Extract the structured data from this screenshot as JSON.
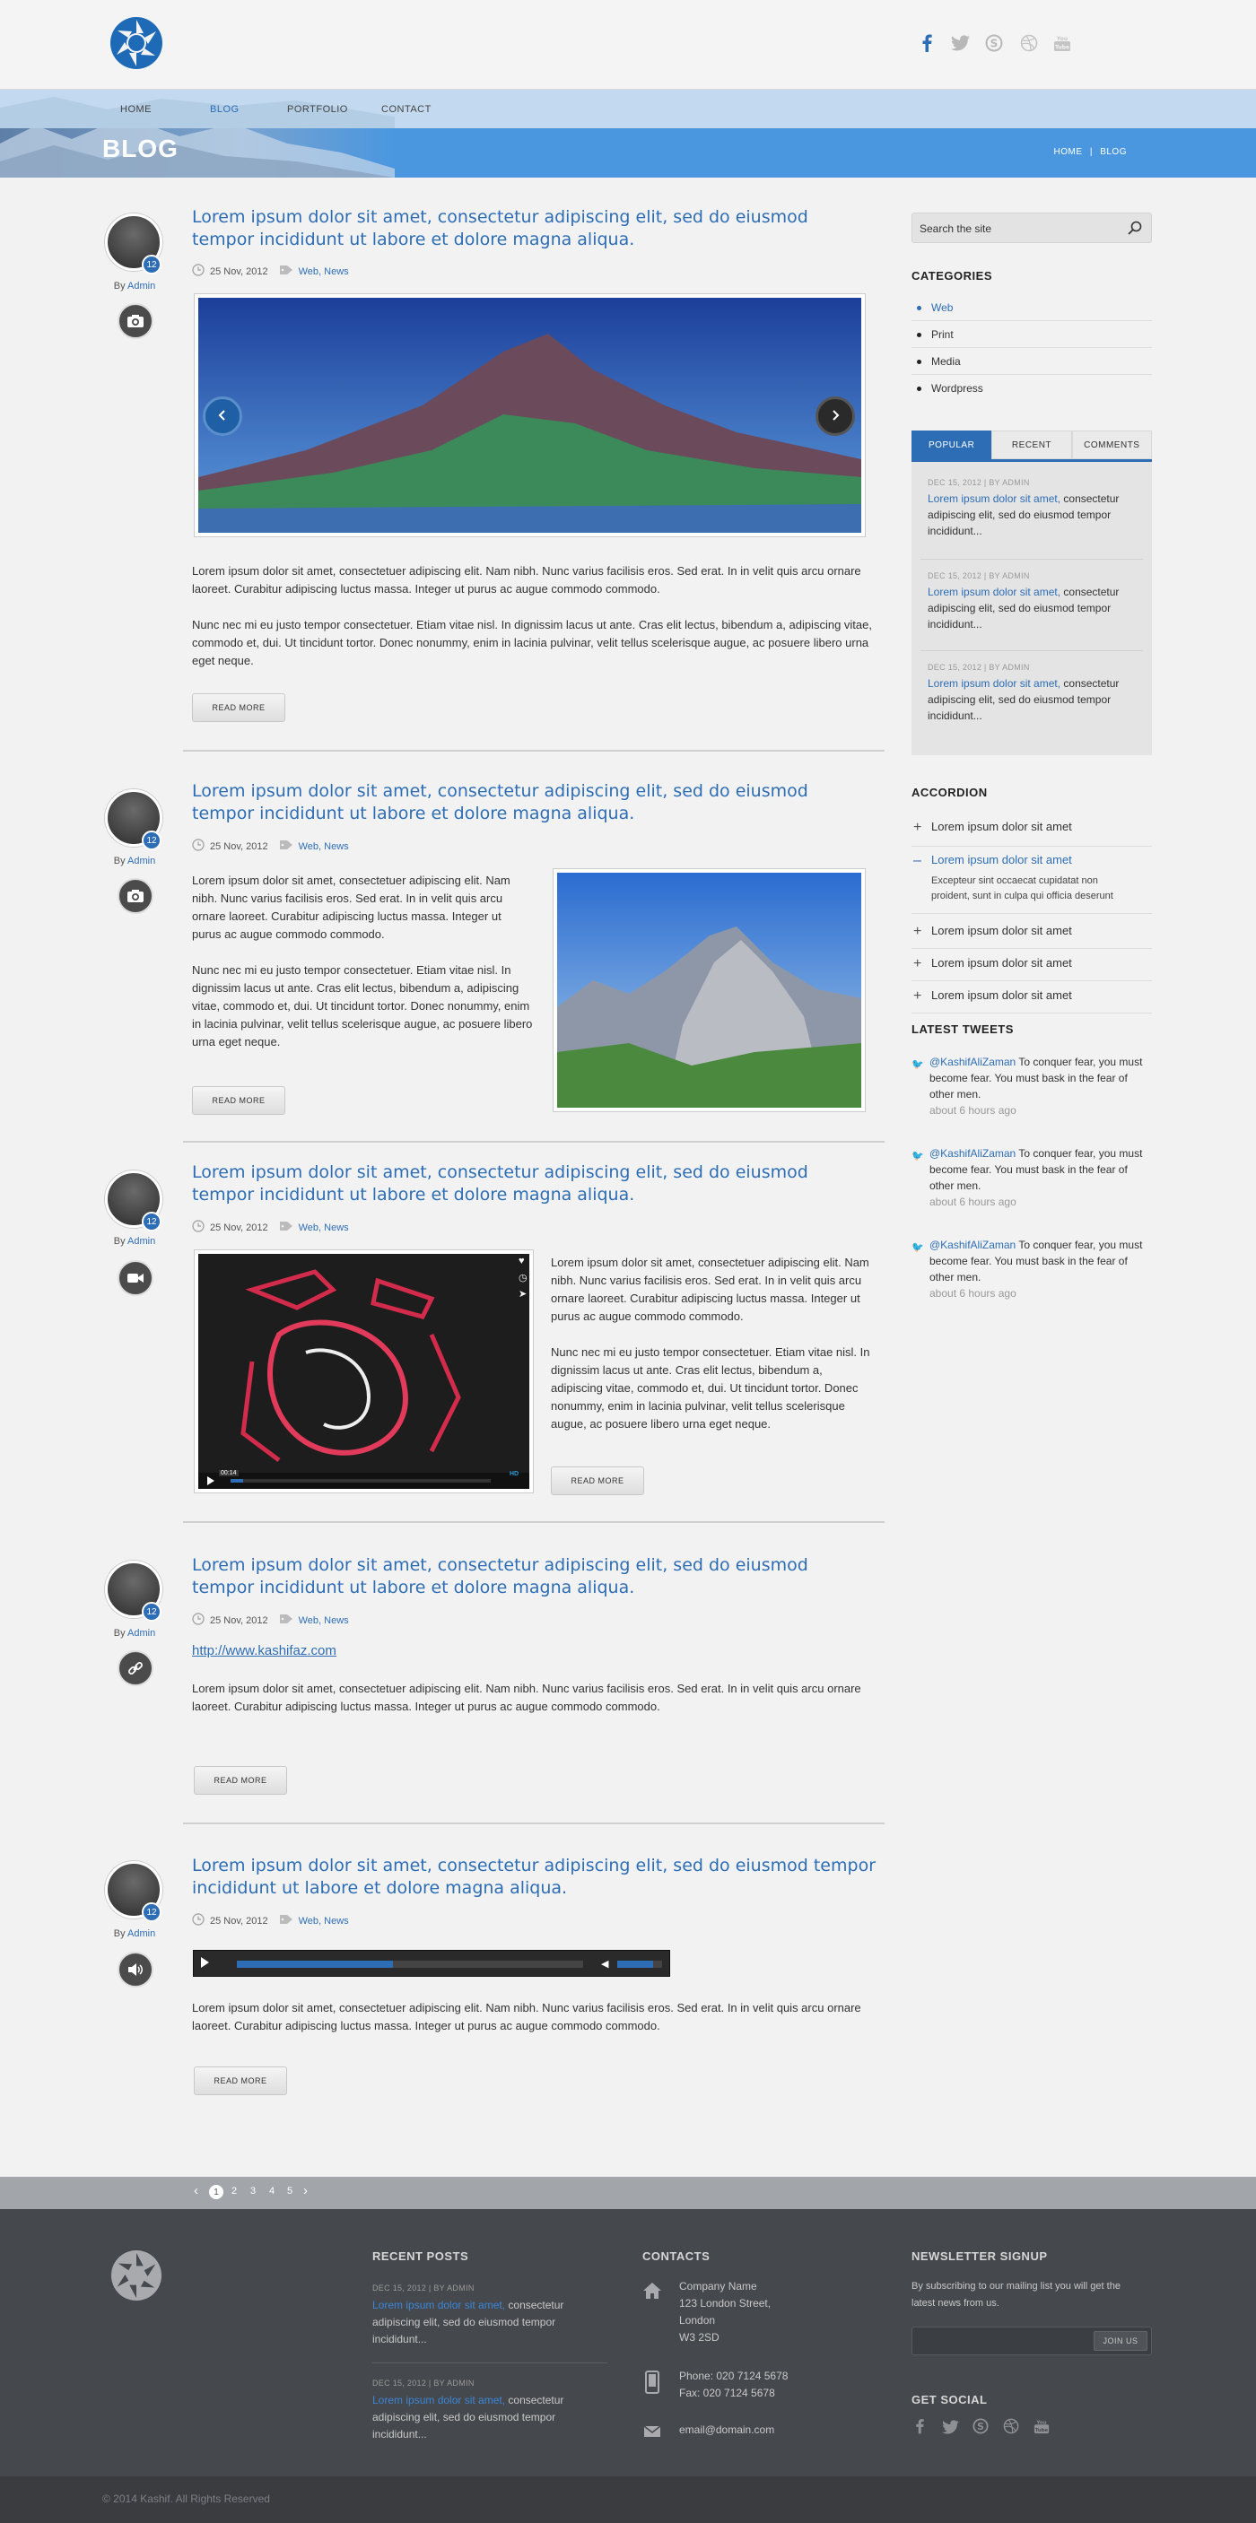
{
  "header": {
    "logo_icon": "aperture-logo-icon",
    "social": [
      "facebook-icon",
      "twitter-icon",
      "skype-icon",
      "dribbble-icon",
      "youtube-icon"
    ]
  },
  "nav": {
    "items": [
      "HOME",
      "BLOG",
      "PORTFOLIO",
      "CONTACT"
    ],
    "active": "BLOG"
  },
  "banner": {
    "title": "BLOG",
    "breadcrumb_home": "HOME",
    "breadcrumb_sep": "|",
    "breadcrumb_current": "BLOG"
  },
  "colors": {
    "accent": "#2d6db5",
    "banner": "#4a97e0",
    "footer": "#45484c"
  },
  "posts": [
    {
      "title": "Lorem ipsum dolor sit amet, consectetur adipiscing elit, sed do eiusmod tempor incididunt ut labore et dolore magna aliqua.",
      "badge": "12",
      "by": "By",
      "author": "Admin",
      "date": "25 Nov, 2012",
      "tags": "Web, News",
      "format_icon": "camera-icon",
      "p1": "Lorem ipsum dolor sit amet, consectetuer adipiscing elit. Nam nibh. Nunc varius facilisis eros. Sed erat. In in velit quis arcu ornare laoreet. Curabitur adipiscing luctus massa. Integer ut purus ac augue commodo commodo.",
      "p2": "Nunc nec mi eu justo tempor consectetuer. Etiam vitae nisl. In dignissim lacus ut ante. Cras elit lectus, bibendum a, adipiscing vitae, commodo et, dui. Ut tincidunt tortor. Donec nonummy, enim in lacinia pulvinar, velit tellus scelerisque augue, ac posuere libero urna eget neque.",
      "readmore": "READ MORE"
    },
    {
      "title": "Lorem ipsum dolor sit amet, consectetur adipiscing elit, sed do eiusmod tempor incididunt ut labore et dolore magna aliqua.",
      "badge": "12",
      "by": "By",
      "author": "Admin",
      "date": "25 Nov, 2012",
      "tags": "Web, News",
      "format_icon": "camera-icon",
      "p1": "Lorem ipsum dolor sit amet, consectetuer adipiscing elit. Nam nibh. Nunc varius facilisis eros. Sed erat. In in velit quis arcu ornare laoreet. Curabitur adipiscing luctus massa. Integer ut purus ac augue commodo commodo.",
      "p2": "Nunc nec mi eu justo tempor consectetuer. Etiam vitae nisl. In dignissim lacus ut ante. Cras elit lectus, bibendum a, adipiscing vitae, commodo et, dui. Ut tincidunt tortor. Donec nonummy, enim in lacinia pulvinar, velit tellus scelerisque augue, ac posuere libero urna eget neque.",
      "readmore": "READ MORE"
    },
    {
      "title": "Lorem ipsum dolor sit amet, consectetur adipiscing elit, sed do eiusmod tempor incididunt ut labore et dolore magna aliqua.",
      "badge": "12",
      "by": "By",
      "author": "Admin",
      "date": "25 Nov, 2012",
      "tags": "Web, News",
      "format_icon": "video-camera-icon",
      "p1": "Lorem ipsum dolor sit amet, consectetuer adipiscing elit. Nam nibh. Nunc varius facilisis eros. Sed erat. In in velit quis arcu ornare laoreet. Curabitur adipiscing luctus massa. Integer ut purus ac augue commodo commodo.",
      "p2": "Nunc nec mi eu justo tempor consectetuer. Etiam vitae nisl. In dignissim lacus ut ante. Cras elit lectus, bibendum a, adipiscing vitae, commodo et, dui. Ut tincidunt tortor. Donec nonummy, enim in lacinia pulvinar, velit tellus scelerisque augue, ac posuere libero urna eget neque.",
      "video_time": "00:14",
      "video_hd": "HD",
      "readmore": "READ MORE"
    },
    {
      "title": "Lorem ipsum dolor sit amet, consectetur adipiscing elit, sed do eiusmod tempor incididunt ut labore et dolore magna aliqua.",
      "badge": "12",
      "by": "By",
      "author": "Admin",
      "date": "25 Nov, 2012",
      "tags": "Web, News",
      "format_icon": "link-icon",
      "link": "http://www.kashifaz.com",
      "p1": "Lorem ipsum dolor sit amet, consectetuer adipiscing elit. Nam nibh. Nunc varius facilisis eros. Sed erat. In in velit quis arcu ornare laoreet. Curabitur adipiscing luctus massa. Integer ut purus ac augue commodo commodo.",
      "readmore": "READ MORE"
    },
    {
      "title": "Lorem ipsum dolor sit amet, consectetur adipiscing elit, sed do eiusmod tempor incididunt ut labore et dolore magna aliqua.",
      "badge": "12",
      "by": "By",
      "author": "Admin",
      "date": "25 Nov, 2012",
      "tags": "Web, News",
      "format_icon": "speaker-icon",
      "audio_progress": 0.45,
      "audio_volume": 0.8,
      "p1": "Lorem ipsum dolor sit amet, consectetuer adipiscing elit. Nam nibh. Nunc varius facilisis eros. Sed erat. In in velit quis arcu ornare laoreet. Curabitur adipiscing luctus massa. Integer ut purus ac augue commodo commodo.",
      "readmore": "READ MORE"
    }
  ],
  "sidebar": {
    "search_placeholder": "Search the site",
    "categories_title": "CATEGORIES",
    "categories": [
      "Web",
      "Print",
      "Media",
      "Wordpress"
    ],
    "active_category": "Web",
    "tabs": [
      "POPULAR",
      "RECENT",
      "COMMENTS"
    ],
    "active_tab": "POPULAR",
    "tab_posts": [
      {
        "date": "DEC 15, 2012  |  BY ADMIN",
        "link": "Lorem ipsum dolor sit amet,",
        "text": " consectetur adipiscing elit, sed do eiusmod tempor incididunt..."
      },
      {
        "date": "DEC 15, 2012  |  BY ADMIN",
        "link": "Lorem ipsum dolor sit amet,",
        "text": " consectetur adipiscing elit, sed do eiusmod tempor incididunt..."
      },
      {
        "date": "DEC 15, 2012  |  BY ADMIN",
        "link": "Lorem ipsum dolor sit amet,",
        "text": " consectetur adipiscing elit, sed do eiusmod tempor incididunt..."
      }
    ],
    "accordion_title": "ACCORDION",
    "accordion": [
      {
        "label": "Lorem ipsum dolor sit amet",
        "open": false
      },
      {
        "label": "Lorem ipsum dolor sit amet",
        "open": true,
        "body": "Excepteur sint occaecat cupidatat non proident, sunt in culpa qui officia deserunt"
      },
      {
        "label": "Lorem ipsum dolor sit amet",
        "open": false
      },
      {
        "label": "Lorem ipsum dolor sit amet",
        "open": false
      },
      {
        "label": "Lorem ipsum dolor sit amet",
        "open": false
      }
    ],
    "tweets_title": "LATEST TWEETS",
    "tweets": [
      {
        "handle": "@KashifAliZaman",
        "text": " To conquer fear, you must become fear. You must bask in the fear of other men.",
        "ago": "about 6 hours ago"
      },
      {
        "handle": "@KashifAliZaman",
        "text": " To conquer fear, you must become fear. You must bask in the fear of other men.",
        "ago": "about 6 hours ago"
      },
      {
        "handle": "@KashifAliZaman",
        "text": " To conquer fear, you must become fear. You must bask in the fear of other men.",
        "ago": "about 6 hours ago"
      }
    ]
  },
  "pagination": {
    "prev": "‹",
    "pages": [
      "1",
      "2",
      "3",
      "4",
      "5"
    ],
    "current": "1",
    "next": "›"
  },
  "footer": {
    "recent_title": "RECENT POSTS",
    "recent": [
      {
        "date": "DEC 15, 2012  |  BY ADMIN",
        "link": "Lorem ipsum dolor sit amet,",
        "text": " consectetur adipiscing elit, sed do eiusmod tempor incididunt..."
      },
      {
        "date": "DEC 15, 2012  |  BY ADMIN",
        "link": "Lorem ipsum dolor sit amet,",
        "text": " consectetur adipiscing elit, sed do eiusmod tempor incididunt..."
      }
    ],
    "contacts_title": "CONTACTS",
    "address": [
      "Company Name",
      "123 London Street,",
      "London",
      "W3 2SD"
    ],
    "phone": "Phone: 020 7124 5678",
    "fax": "Fax: 020 7124 5678",
    "email": "email@domain.com",
    "newsletter_title": "NEWSLETTER SIGNUP",
    "newsletter_text": "By subscribing to our mailing list you will get the latest news from us.",
    "join_label": "JOIN US",
    "social_title": "GET SOCIAL",
    "copyright": "© 2014 Kashif. All Rights Reserved"
  }
}
